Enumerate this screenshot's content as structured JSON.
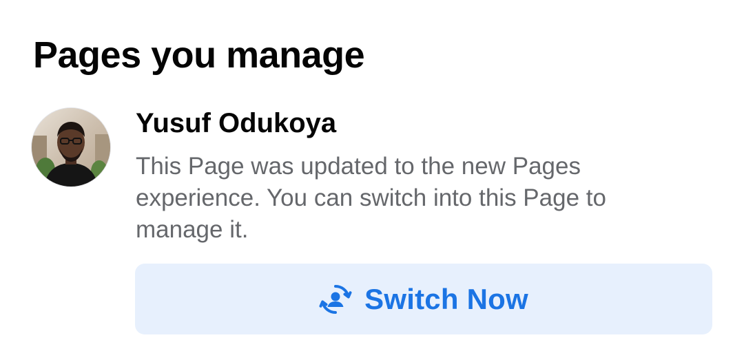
{
  "section": {
    "title": "Pages you manage"
  },
  "page": {
    "name": "Yusuf Odukoya",
    "description": "This Page was updated to the new Pages experience. You can switch into this Page to manage it.",
    "avatar_icon": "profile-photo"
  },
  "action": {
    "label": "Switch Now",
    "icon": "switch-profile-icon"
  },
  "colors": {
    "accent": "#1b74e4",
    "button_bg": "#e7f0fd",
    "secondary_text": "#65676b",
    "primary_text": "#050505"
  }
}
